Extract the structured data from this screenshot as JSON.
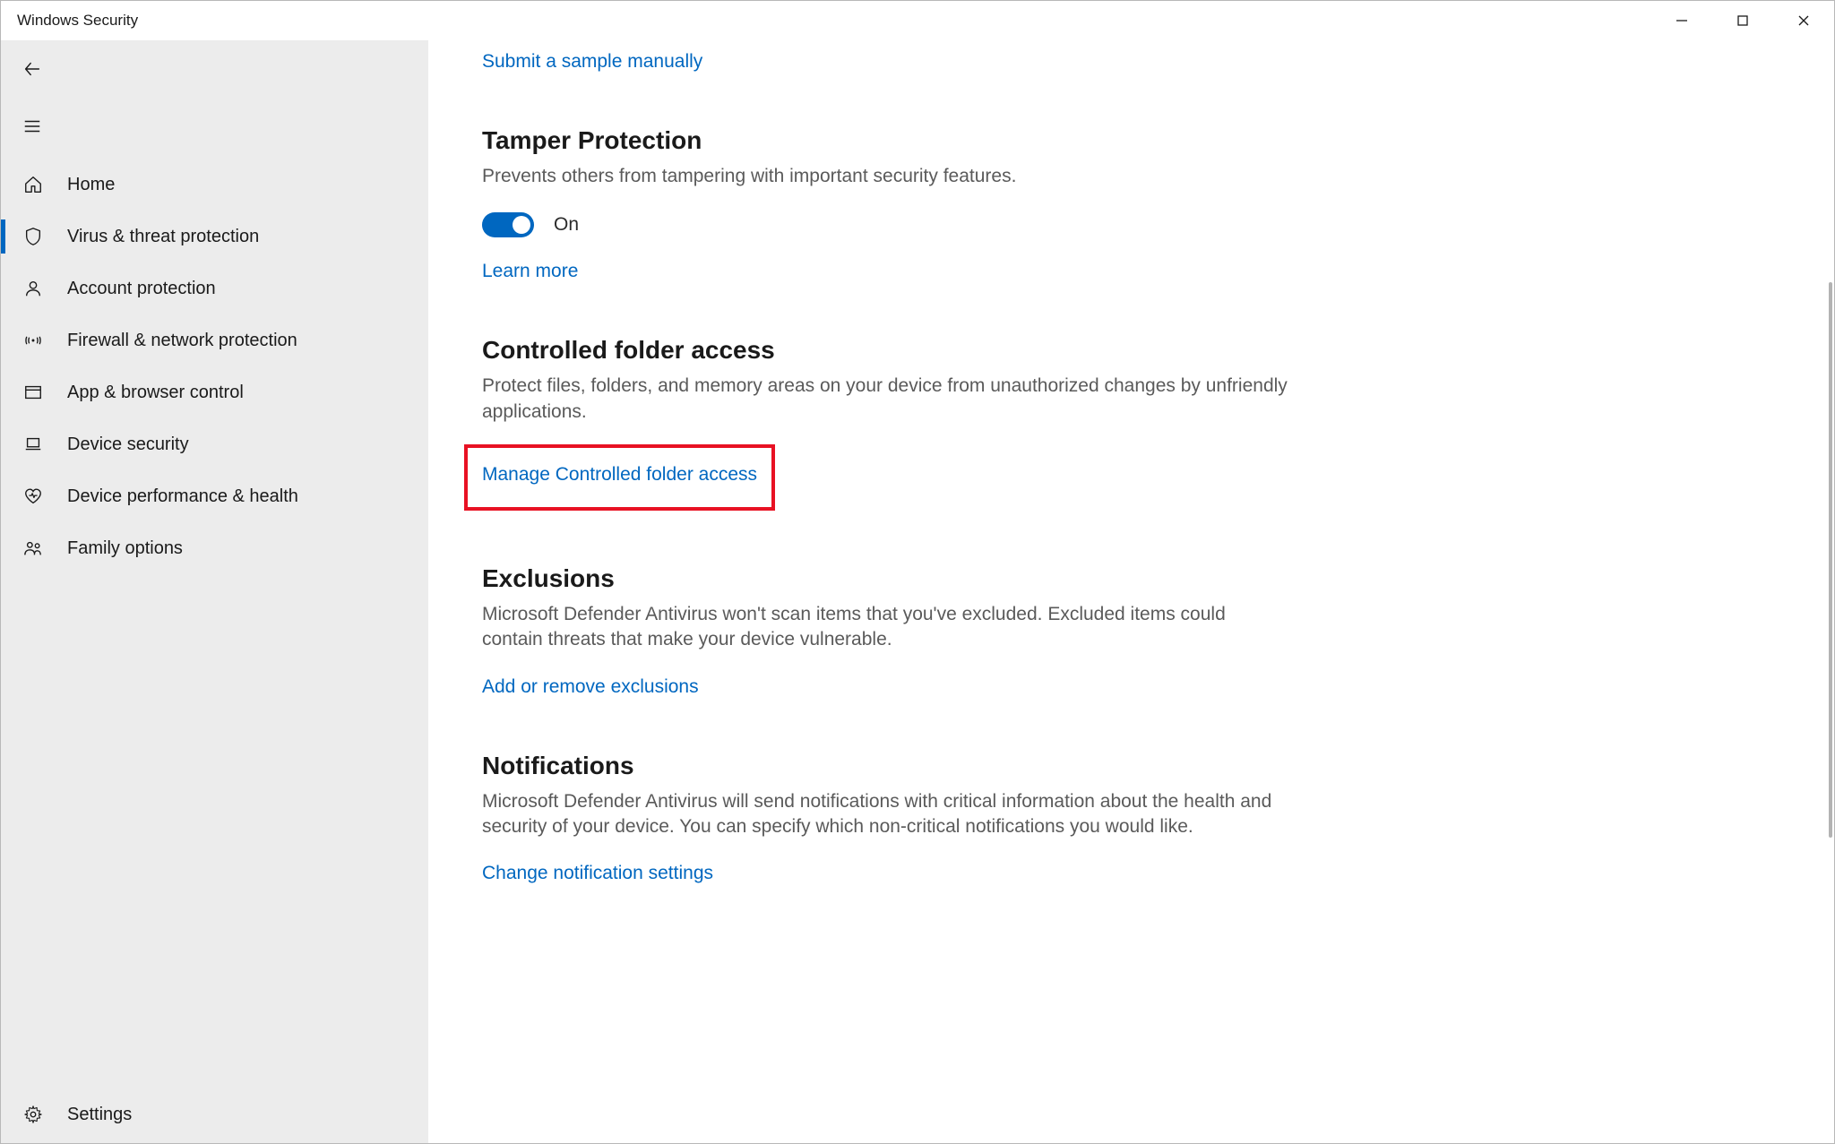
{
  "window": {
    "title": "Windows Security"
  },
  "sidebar": {
    "items": [
      {
        "icon": "home",
        "label": "Home"
      },
      {
        "icon": "shield",
        "label": "Virus & threat protection",
        "selected": true
      },
      {
        "icon": "person",
        "label": "Account protection"
      },
      {
        "icon": "signal",
        "label": "Firewall & network protection"
      },
      {
        "icon": "browser",
        "label": "App & browser control"
      },
      {
        "icon": "laptop",
        "label": "Device security"
      },
      {
        "icon": "heart",
        "label": "Device performance & health"
      },
      {
        "icon": "family",
        "label": "Family options"
      }
    ],
    "settings_label": "Settings"
  },
  "main": {
    "submit_sample_link": "Submit a sample manually",
    "tamper": {
      "heading": "Tamper Protection",
      "desc": "Prevents others from tampering with important security features.",
      "toggle_state": "On",
      "learn_more": "Learn more"
    },
    "cfa": {
      "heading": "Controlled folder access",
      "desc": "Protect files, folders, and memory areas on your device from unauthorized changes by unfriendly applications.",
      "manage_link": "Manage Controlled folder access"
    },
    "exclusions": {
      "heading": "Exclusions",
      "desc": "Microsoft Defender Antivirus won't scan items that you've excluded. Excluded items could contain threats that make your device vulnerable.",
      "link": "Add or remove exclusions"
    },
    "notifications": {
      "heading": "Notifications",
      "desc": "Microsoft Defender Antivirus will send notifications with critical information about the health and security of your device. You can specify which non-critical notifications you would like.",
      "link": "Change notification settings"
    }
  }
}
